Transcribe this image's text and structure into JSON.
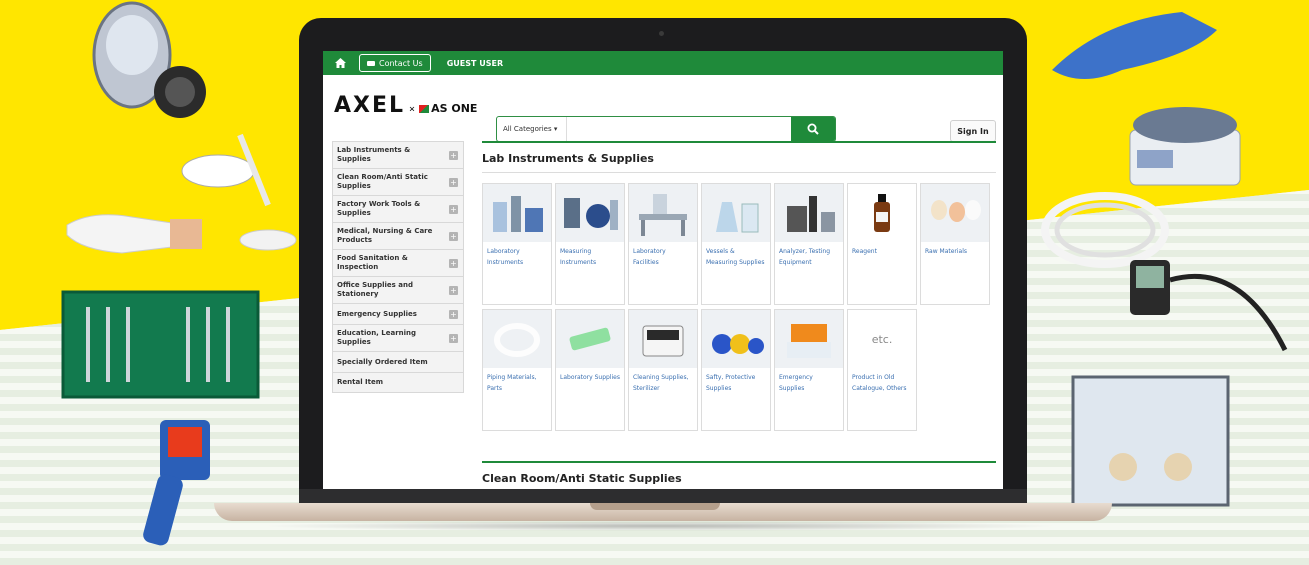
{
  "topbar": {
    "home_icon": "home-icon",
    "contact_label": "Contact Us",
    "guest_label": "GUEST USER"
  },
  "header": {
    "logo_axel": "AXEL",
    "logo_x": "×",
    "logo_asone": "AS ONE",
    "search": {
      "category": "All Categories",
      "placeholder": ""
    },
    "signin_label": "Sign In"
  },
  "sidebar": {
    "items": [
      {
        "label": "Lab Instruments & Supplies"
      },
      {
        "label": "Clean Room/Anti Static Supplies"
      },
      {
        "label": "Factory Work Tools & Supplies"
      },
      {
        "label": "Medical, Nursing & Care Products"
      },
      {
        "label": "Food Sanitation & Inspection"
      },
      {
        "label": "Office Supplies and Stationery"
      },
      {
        "label": "Emergency Supplies"
      },
      {
        "label": "Education, Learning Supplies"
      },
      {
        "label": "Specially Ordered Item"
      },
      {
        "label": "Rental Item"
      }
    ]
  },
  "main": {
    "section1_title": "Lab Instruments & Supplies",
    "section2_title": "Clean Room/Anti Static Supplies",
    "cards": [
      {
        "label": "Laboratory Instruments"
      },
      {
        "label": "Measuring Instruments"
      },
      {
        "label": "Laboratory Facilities"
      },
      {
        "label": "Vessels & Measuring Supplies"
      },
      {
        "label": "Analyzer, Testing Equipment"
      },
      {
        "label": "Reagent"
      },
      {
        "label": "Raw Materials"
      },
      {
        "label": "Piping Materials, Parts"
      },
      {
        "label": "Laboratory Supplies"
      },
      {
        "label": "Cleaning Supplies, Sterilizer"
      },
      {
        "label": "Safty, Protective Supplies"
      },
      {
        "label": "Emergency Supplies"
      },
      {
        "label": "Product in Old Catalogue, Others"
      }
    ],
    "etc_text": "etc."
  },
  "colors": {
    "brand_green": "#1f8a3a",
    "banner_yellow": "#ffe600",
    "link_blue": "#3a6fb0"
  }
}
